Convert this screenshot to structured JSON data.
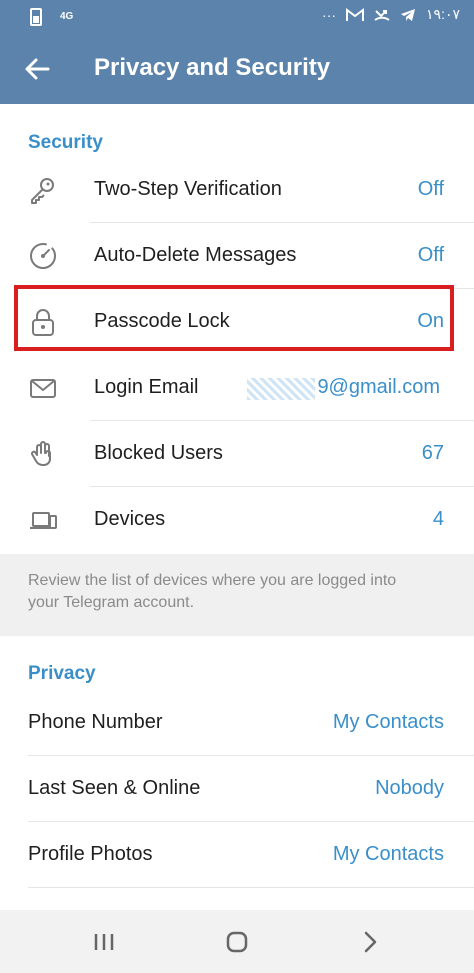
{
  "status_bar": {
    "network": "4G",
    "time": "١٩:٠٧",
    "more": "···"
  },
  "header": {
    "title": "Privacy and Security"
  },
  "security": {
    "title": "Security",
    "items": [
      {
        "label": "Two-Step Verification",
        "value": "Off",
        "icon": "key-icon"
      },
      {
        "label": "Auto-Delete Messages",
        "value": "Off",
        "icon": "timer-icon"
      },
      {
        "label": "Passcode Lock",
        "value": "On",
        "icon": "lock-icon"
      },
      {
        "label": "Login Email",
        "value": "9@gmail.com",
        "icon": "mail-icon"
      },
      {
        "label": "Blocked Users",
        "value": "67",
        "icon": "hand-icon"
      },
      {
        "label": "Devices",
        "value": "4",
        "icon": "devices-icon"
      }
    ],
    "info": "Review the list of devices where you are logged into your Telegram account."
  },
  "privacy": {
    "title": "Privacy",
    "items": [
      {
        "label": "Phone Number",
        "value": "My Contacts"
      },
      {
        "label": "Last Seen & Online",
        "value": "Nobody"
      },
      {
        "label": "Profile Photos",
        "value": "My Contacts"
      }
    ]
  },
  "colors": {
    "app_bar": "#5b83ab",
    "accent": "#3a8fc9",
    "highlight_border": "#d81e1e"
  }
}
